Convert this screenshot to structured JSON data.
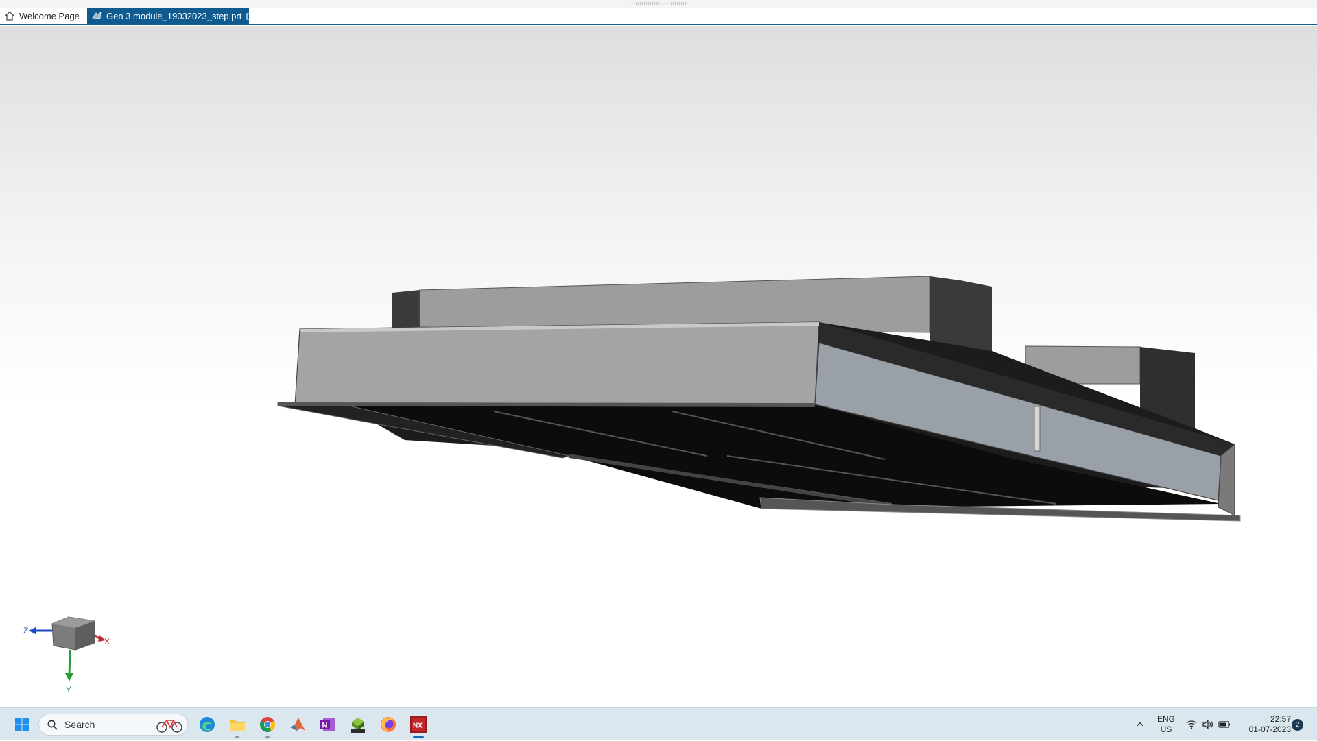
{
  "tabs": [
    {
      "label": "Welcome Page",
      "icon": "home-icon",
      "active": false
    },
    {
      "label": "Gen 3 module_19032023_step.prt",
      "icon": "part-file-icon",
      "active": true
    }
  ],
  "triad": {
    "x_label": "X",
    "y_label": "Y",
    "z_label": "Z"
  },
  "colors": {
    "tab_active": "#0f5a8f",
    "axis_x": "#c0282d",
    "axis_y": "#2c9c3a",
    "axis_z": "#1a45c9",
    "model_face_light": "#a6a6a6",
    "model_face_dark": "#3a3a3a",
    "taskbar": "#dbe7ee"
  },
  "taskbar": {
    "search_placeholder": "Search",
    "apps": [
      "start-icon",
      "edge-icon",
      "file-explorer-icon",
      "chrome-icon",
      "matlab-icon",
      "onenote-icon",
      "inventor-2022-icon",
      "firefox-icon",
      "nx-icon"
    ],
    "language_line1": "ENG",
    "language_line2": "US",
    "time": "22:57",
    "date": "01-07-2023",
    "notification_count": "2"
  }
}
